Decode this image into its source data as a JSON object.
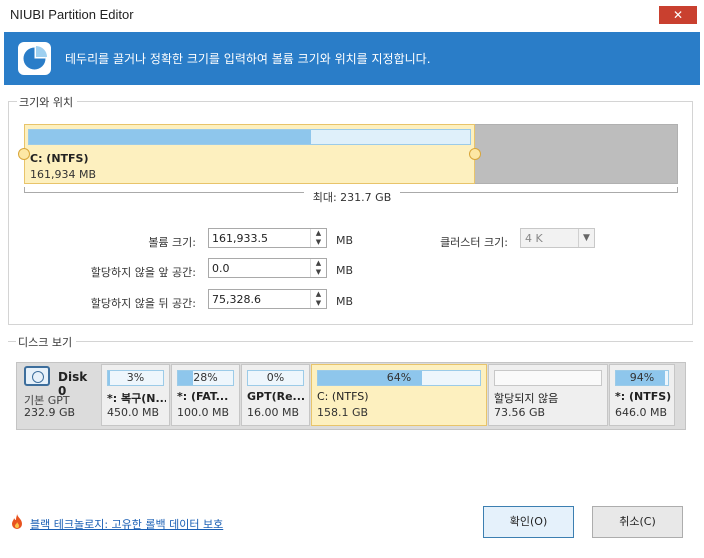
{
  "window": {
    "title": "NIUBI Partition Editor",
    "close_glyph": "✕"
  },
  "banner": {
    "text": "테두리를 끌거나 정확한 크기를 입력하여 볼륨 크기와 위치를 지정합니다."
  },
  "size_position": {
    "legend": "크기와 위치",
    "partition_name": "C: (NTFS)",
    "partition_size": "161,934 MB",
    "max_label": "최대: 231.7 GB",
    "used_fraction": 0.64
  },
  "fields": {
    "volume_size_label": "볼륨 크기:",
    "volume_size_value": "161,933.5",
    "unalloc_before_label": "할당하지 않을 앞 공간:",
    "unalloc_before_value": "0.0",
    "unalloc_after_label": "할당하지 않을 뒤 공간:",
    "unalloc_after_value": "75,328.6",
    "unit": "MB",
    "cluster_label": "클러스터 크기:",
    "cluster_value": "4 K"
  },
  "disk_view": {
    "legend": "디스크 보기",
    "disk_name": "Disk 0",
    "disk_type": "기본 GPT",
    "disk_size": "232.9 GB",
    "partitions": [
      {
        "pct": "3%",
        "fill": 0.03,
        "name": "*: 복구(N...",
        "size": "450.0 MB"
      },
      {
        "pct": "28%",
        "fill": 0.28,
        "name": "*: (FAT...",
        "size": "100.0 MB"
      },
      {
        "pct": "0%",
        "fill": 0.0,
        "name": "GPT(Re...",
        "size": "16.00 MB"
      },
      {
        "pct": "64%",
        "fill": 0.64,
        "name": "C: (NTFS)",
        "size": "158.1 GB"
      },
      {
        "pct": "",
        "fill": 0.0,
        "name": "할당되지 않음",
        "size": "73.56 GB"
      },
      {
        "pct": "94%",
        "fill": 0.94,
        "name": "*: (NTFS)",
        "size": "646.0 MB"
      }
    ]
  },
  "footer": {
    "link_text": "블랙 테크놀로지: 고유한 롤백 데이터 보호",
    "ok_label": "확인(O)",
    "cancel_label": "취소(C)"
  },
  "colors": {
    "accent": "#2a7dc8",
    "partition_selected": "#fdf0bf",
    "used_bar": "#8ec6ec",
    "unallocated": "#bdbdbd"
  }
}
